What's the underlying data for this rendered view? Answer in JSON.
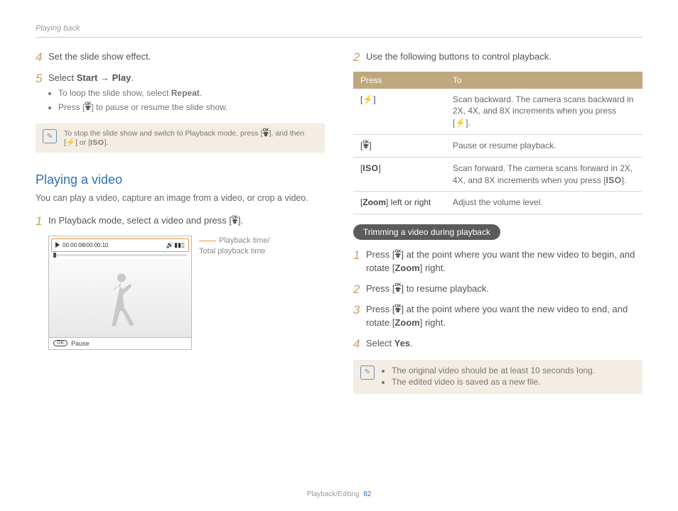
{
  "header": {
    "section": "Playing back"
  },
  "left": {
    "step4": {
      "num": "4",
      "text": "Set the slide show effect."
    },
    "step5": {
      "num": "5",
      "prefix": "Select ",
      "bold1": "Start",
      "arrow": " → ",
      "bold2": "Play",
      "suffix": ".",
      "bullets": {
        "b1_pre": "To loop the slide show, select ",
        "b1_bold": "Repeat",
        "b1_post": ".",
        "b2_pre": "Press [",
        "b2_post": "] to pause or resume the slide show."
      }
    },
    "note": {
      "pre": "To stop the slide show and switch to Playback mode, press [",
      "mid": "], and then [",
      "or": "] or [",
      "iso": "ISO",
      "end": "]."
    },
    "video_section": {
      "title": "Playing a video",
      "desc": "You can play a video, capture an image from a video, or crop a video.",
      "step1": {
        "num": "1",
        "pre": "In Playback mode, select a video and press [",
        "post": "]."
      },
      "time_display": "00:00:08/00:00:10",
      "pause_label": "Pause",
      "ok_label": "OK",
      "caption_line1": "Playback time/",
      "caption_line2": "Total playback time"
    }
  },
  "right": {
    "step2": {
      "num": "2",
      "text": "Use the following buttons to control playback."
    },
    "table": {
      "head_press": "Press",
      "head_to": "To",
      "rows": {
        "r1_key_pre": "[",
        "r1_key_post": "]",
        "r1_desc_a": "Scan backward. The camera scans backward in 2X, 4X, and 8X increments when you press [",
        "r1_desc_b": "].",
        "r2_key_pre": "[",
        "r2_key_post": "]",
        "r2_desc": "Pause or resume playback.",
        "r3_key_pre": "[",
        "r3_key_iso": "ISO",
        "r3_key_post": "]",
        "r3_desc_a": "Scan forward. The camera scans forward in 2X, 4X, and 8X increments when you press [",
        "r3_desc_iso": "ISO",
        "r3_desc_b": "].",
        "r4_key_pre": "[",
        "r4_key_bold": "Zoom",
        "r4_key_post": "] left or right",
        "r4_desc": "Adjust the volume level."
      }
    },
    "trimming": {
      "heading": "Trimming a video during playback",
      "s1": {
        "num": "1",
        "a": "Press [",
        "b": "] at the point where you want the new video to begin, and rotate [",
        "zoom": "Zoom",
        "c": "] right."
      },
      "s2": {
        "num": "2",
        "a": "Press [",
        "b": "] to resume playback."
      },
      "s3": {
        "num": "3",
        "a": "Press [",
        "b": "] at the point where you want the new video to end, and rotate [",
        "zoom": "Zoom",
        "c": "] right."
      },
      "s4": {
        "num": "4",
        "a": "Select ",
        "yes": "Yes",
        "b": "."
      },
      "note": {
        "b1": "The original video should be at least 10 seconds long.",
        "b2": "The edited video is saved as a new file."
      }
    }
  },
  "footer": {
    "category": "Playback/Editing",
    "page": "82"
  }
}
